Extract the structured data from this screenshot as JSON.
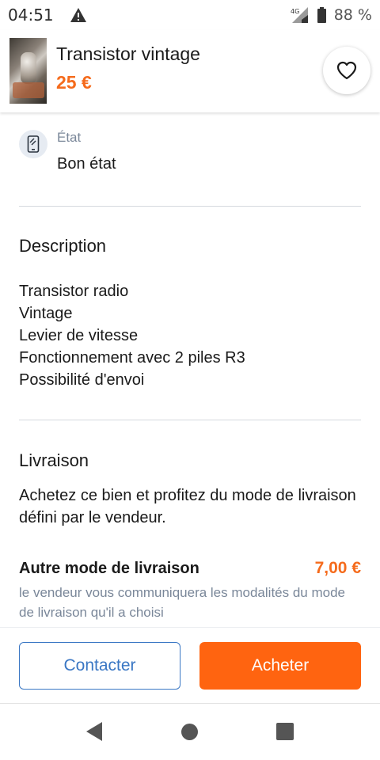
{
  "status_bar": {
    "time": "04:51",
    "network": "4G",
    "battery": "88 %",
    "icons": [
      "warning-icon",
      "signal-icon",
      "battery-icon"
    ]
  },
  "header": {
    "title": "Transistor vintage",
    "price": "25 €",
    "favorite_icon": "heart-outline-icon"
  },
  "state": {
    "label": "État",
    "value": "Bon état",
    "icon": "phone-icon"
  },
  "description": {
    "title": "Description",
    "lines": [
      "Transistor radio",
      "Vintage",
      "Levier de vitesse",
      "Fonctionnement avec 2 piles R3",
      "Possibilité d'envoi"
    ]
  },
  "delivery": {
    "title": "Livraison",
    "text": "Achetez ce bien et profitez du mode de livraison défini par le vendeur.",
    "other_label": "Autre mode de livraison",
    "other_price": "7,00 €",
    "other_note": "le vendeur vous communiquera les modalités du mode de livraison qu'il a choisi"
  },
  "actions": {
    "contact": "Contacter",
    "buy": "Acheter"
  },
  "colors": {
    "accent": "#ff6410",
    "price": "#f56b1c",
    "link": "#3a77c4",
    "muted": "#7a8799"
  }
}
